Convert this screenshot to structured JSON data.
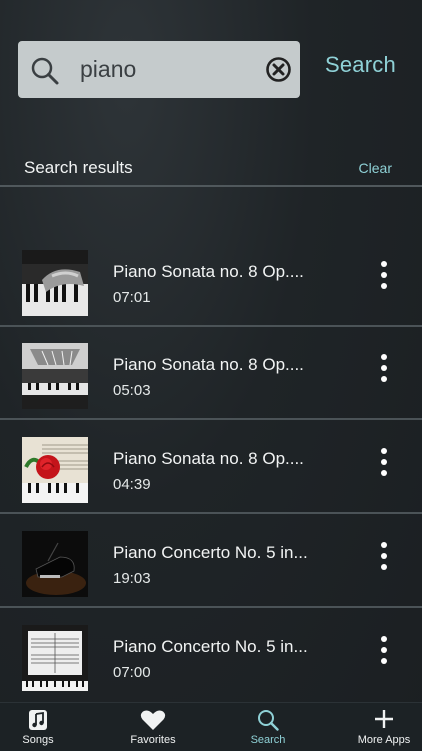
{
  "search": {
    "query": "piano",
    "button_label": "Search"
  },
  "results": {
    "header": "Search results",
    "clear_label": "Clear",
    "items": [
      {
        "title": "Piano Sonata no. 8 Op....",
        "duration": "07:01",
        "thumb": "hands-on-piano-image"
      },
      {
        "title": "Piano Sonata no. 8 Op....",
        "duration": "05:03",
        "thumb": "piano-interior-image"
      },
      {
        "title": "Piano Sonata no. 8 Op....",
        "duration": "04:39",
        "thumb": "rose-on-sheet-music-image"
      },
      {
        "title": "Piano Concerto No. 5 in...",
        "duration": "19:03",
        "thumb": "grand-piano-stage-image"
      },
      {
        "title": "Piano Concerto No. 5 in...",
        "duration": "07:00",
        "thumb": "sheet-music-on-piano-image"
      }
    ]
  },
  "tabbar": {
    "tabs": [
      {
        "label": "Songs",
        "icon": "music-note-icon"
      },
      {
        "label": "Favorites",
        "icon": "heart-icon"
      },
      {
        "label": "Search",
        "icon": "search-icon"
      },
      {
        "label": "More Apps",
        "icon": "plus-icon"
      }
    ],
    "active": "Search"
  },
  "colors": {
    "accent": "#8fd1d6",
    "background": "#1f2427",
    "search_field": "#c5cbcc"
  }
}
